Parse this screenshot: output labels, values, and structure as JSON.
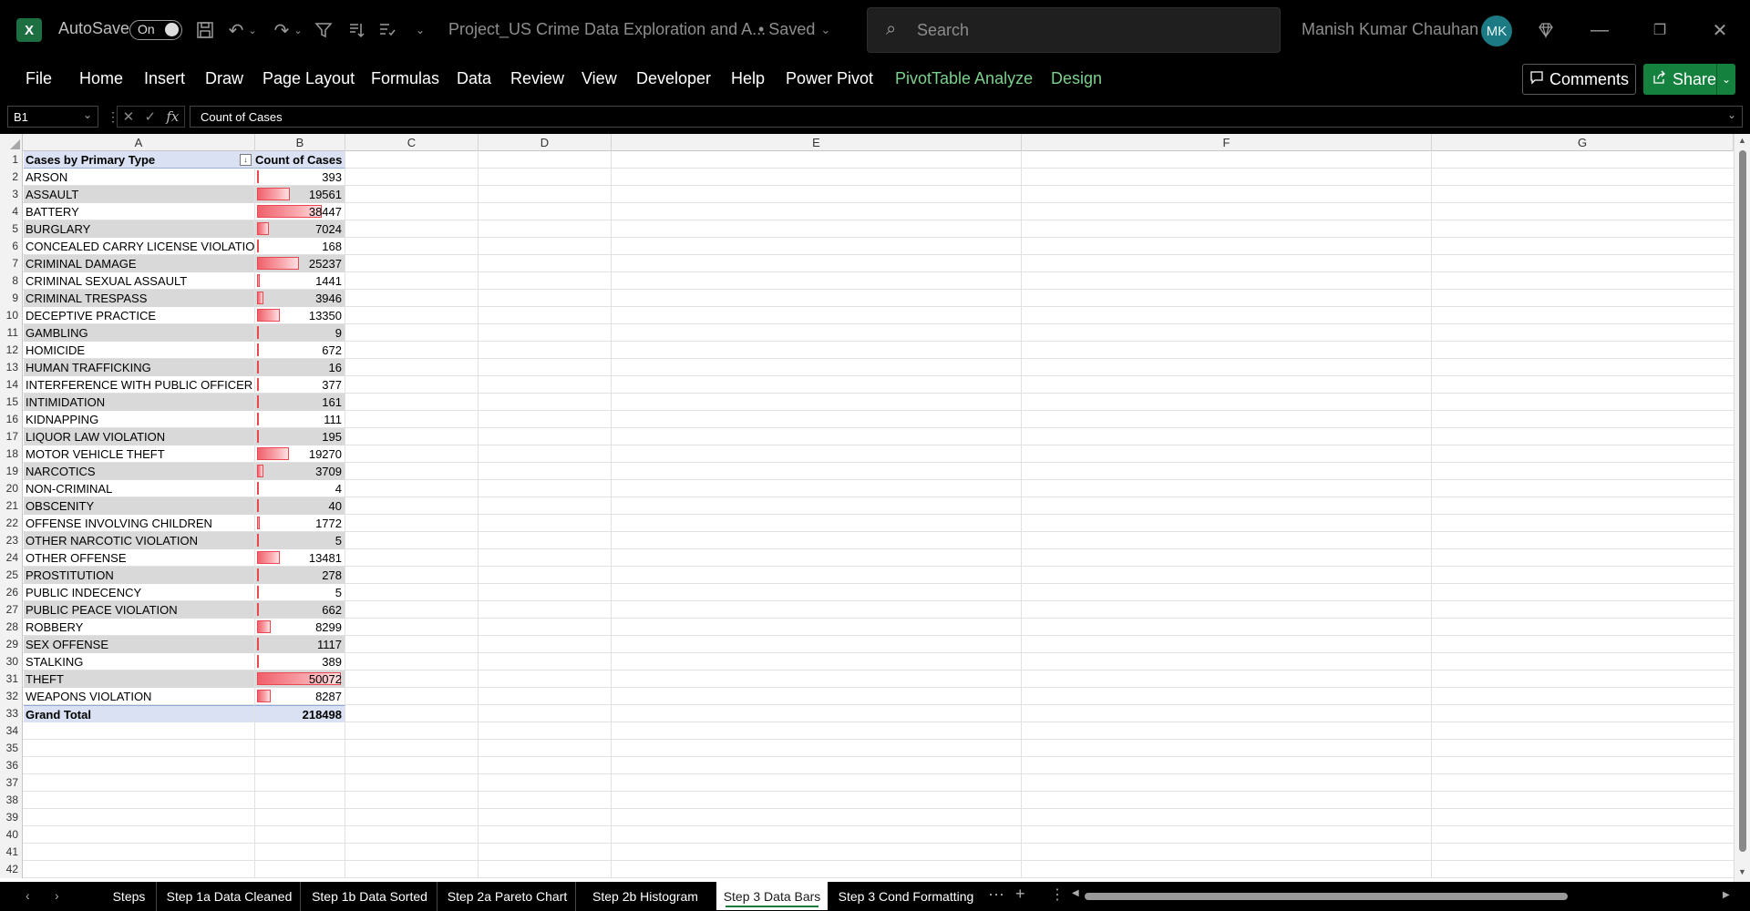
{
  "app": {
    "logo_letter": "X",
    "autosave_label": "AutoSave",
    "autosave_state": "On",
    "document_title": "Project_US Crime Data Exploration and A...",
    "save_status": "• Saved",
    "search_placeholder": "Search",
    "user_name": "Manish Kumar Chauhan",
    "user_initials": "MK"
  },
  "menu": {
    "items": [
      "File",
      "Home",
      "Insert",
      "Draw",
      "Page Layout",
      "Formulas",
      "Data",
      "Review",
      "View",
      "Developer",
      "Help",
      "Power Pivot",
      "PivotTable Analyze",
      "Design"
    ],
    "comments_label": "Comments",
    "share_label": "Share"
  },
  "formula_bar": {
    "cell_ref": "B1",
    "content": "Count of Cases"
  },
  "columns": [
    "A",
    "B",
    "C",
    "D",
    "E",
    "F",
    "G"
  ],
  "pivot": {
    "header_a": "Cases by Primary Type",
    "header_b": "Count of Cases",
    "max_value": 50072,
    "rows": [
      {
        "type": "ARSON",
        "count": 393
      },
      {
        "type": "ASSAULT",
        "count": 19561
      },
      {
        "type": "BATTERY",
        "count": 38447
      },
      {
        "type": "BURGLARY",
        "count": 7024
      },
      {
        "type": "CONCEALED CARRY LICENSE VIOLATION",
        "count": 168
      },
      {
        "type": "CRIMINAL DAMAGE",
        "count": 25237
      },
      {
        "type": "CRIMINAL SEXUAL ASSAULT",
        "count": 1441
      },
      {
        "type": "CRIMINAL TRESPASS",
        "count": 3946
      },
      {
        "type": "DECEPTIVE PRACTICE",
        "count": 13350
      },
      {
        "type": "GAMBLING",
        "count": 9
      },
      {
        "type": "HOMICIDE",
        "count": 672
      },
      {
        "type": "HUMAN TRAFFICKING",
        "count": 16
      },
      {
        "type": "INTERFERENCE WITH PUBLIC OFFICER",
        "count": 377
      },
      {
        "type": "INTIMIDATION",
        "count": 161
      },
      {
        "type": "KIDNAPPING",
        "count": 111
      },
      {
        "type": "LIQUOR LAW VIOLATION",
        "count": 195
      },
      {
        "type": "MOTOR VEHICLE THEFT",
        "count": 19270
      },
      {
        "type": "NARCOTICS",
        "count": 3709
      },
      {
        "type": "NON-CRIMINAL",
        "count": 4
      },
      {
        "type": "OBSCENITY",
        "count": 40
      },
      {
        "type": "OFFENSE INVOLVING CHILDREN",
        "count": 1772
      },
      {
        "type": "OTHER NARCOTIC VIOLATION",
        "count": 5
      },
      {
        "type": "OTHER OFFENSE",
        "count": 13481
      },
      {
        "type": "PROSTITUTION",
        "count": 278
      },
      {
        "type": "PUBLIC INDECENCY",
        "count": 5
      },
      {
        "type": "PUBLIC PEACE VIOLATION",
        "count": 662
      },
      {
        "type": "ROBBERY",
        "count": 8299
      },
      {
        "type": "SEX OFFENSE",
        "count": 1117
      },
      {
        "type": "STALKING",
        "count": 389
      },
      {
        "type": "THEFT",
        "count": 50072
      },
      {
        "type": "WEAPONS VIOLATION",
        "count": 8287
      }
    ],
    "total_label": "Grand Total",
    "total_value": 218498
  },
  "sheet_tabs": [
    "Steps",
    "Step 1a Data Cleaned",
    "Step 1b Data Sorted",
    "Step 2a Pareto Chart",
    "Step 2b Histogram",
    "Step 3 Data Bars",
    "Step 3 Cond Formatting"
  ],
  "active_tab": "Step 3 Data Bars",
  "colors": {
    "excel_green": "#1d6f42",
    "share_green": "#14813f",
    "context_tab_green": "#7ccf8d",
    "data_bar_red": "#f0606b",
    "pivot_header_blue": "#d9e1f2",
    "avatar_teal": "#1b7a83"
  }
}
